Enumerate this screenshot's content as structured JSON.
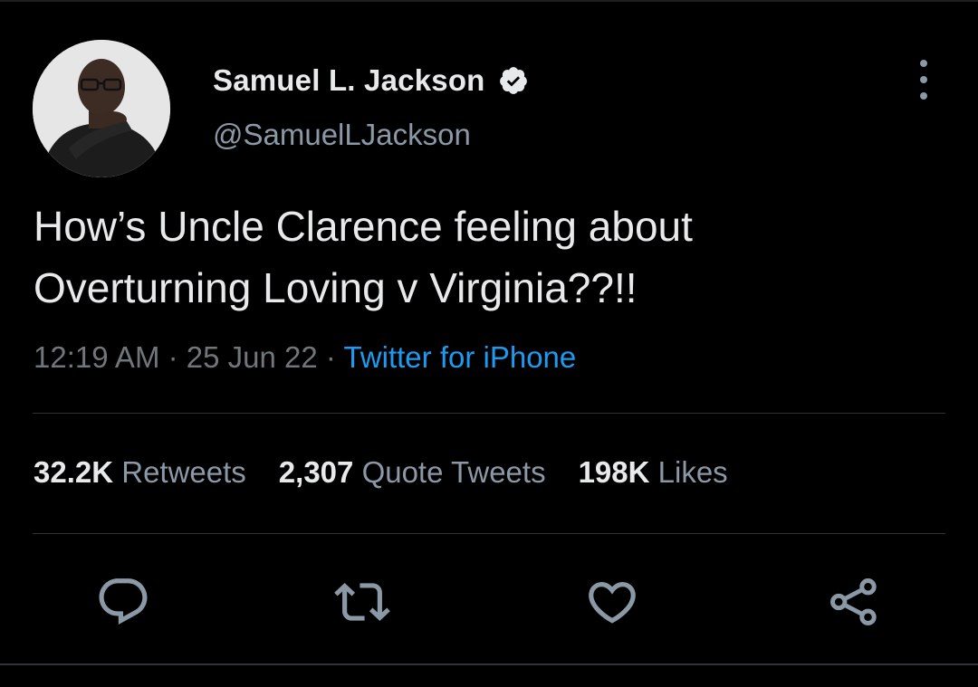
{
  "author": {
    "display_name": "Samuel L. Jackson",
    "handle": "@SamuelLJackson",
    "verified": true
  },
  "tweet": {
    "text": "How’s Uncle Clarence feeling about\nOverturning Loving v Virginia??!!",
    "time": "12:19 AM",
    "separator": " · ",
    "date": "25 Jun 22",
    "source": "Twitter for iPhone"
  },
  "stats": {
    "retweets_count": "32.2K",
    "retweets_label": "Retweets",
    "quotes_count": "2,307",
    "quotes_label": "Quote Tweets",
    "likes_count": "198K",
    "likes_label": "Likes"
  },
  "icons": {
    "more": "more-vertical-icon",
    "verified": "verified-badge-icon",
    "reply": "reply-icon",
    "retweet": "retweet-icon",
    "like": "heart-icon",
    "share": "share-icon"
  },
  "colors": {
    "background": "#000000",
    "text_primary": "#e7e9ea",
    "text_secondary": "#8b98a5",
    "link": "#1d9bf0",
    "divider": "#2f3336"
  }
}
